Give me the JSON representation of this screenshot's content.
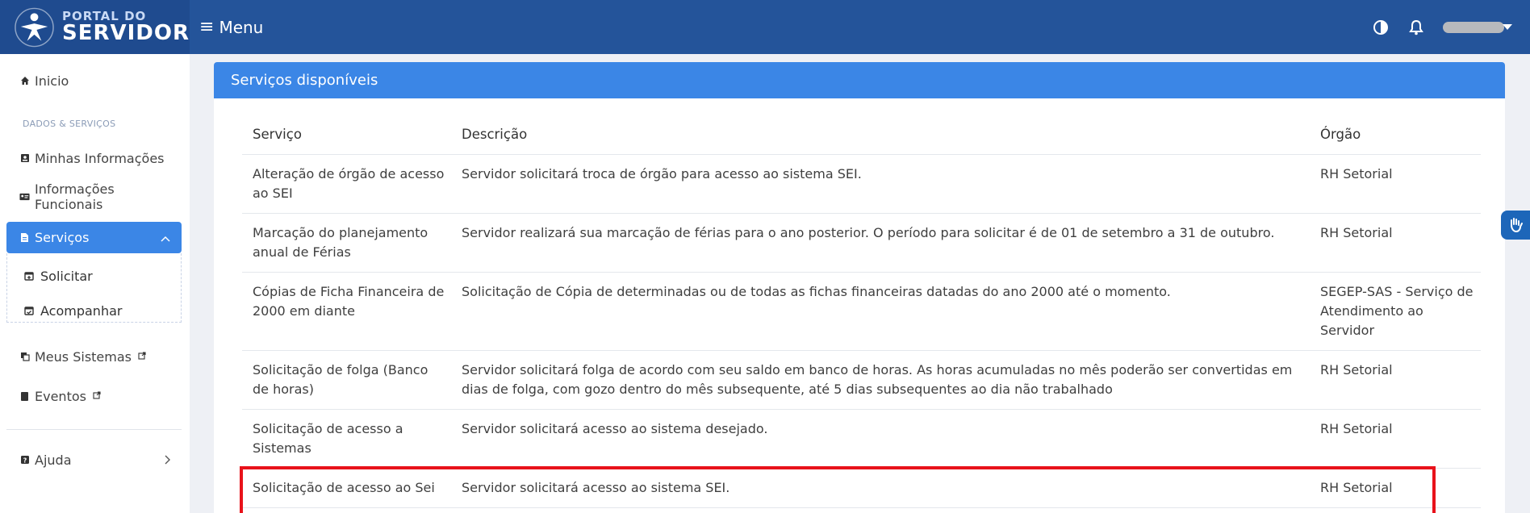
{
  "header": {
    "logo_line1": "PORTAL DO",
    "logo_line2": "SERVIDOR",
    "menu_label": "Menu",
    "icons": [
      "contrast-icon",
      "bell-icon",
      "user-menu-caret-icon"
    ],
    "colors": {
      "header_bg": "#24549a",
      "accent": "#3b86e6",
      "highlight": "#e8121b"
    }
  },
  "sidebar": {
    "inicio": "Inicio",
    "section": "DADOS & SERVIÇOS",
    "minhas": "Minhas Informações",
    "funcionais": "Informações Funcionais",
    "servicos": "Serviços",
    "solicitar": "Solicitar",
    "acompanhar": "Acompanhar",
    "sistemas": "Meus Sistemas",
    "eventos": "Eventos",
    "ajuda": "Ajuda"
  },
  "panel": {
    "title": "Serviços disponíveis",
    "columns": [
      "Serviço",
      "Descrição",
      "Órgão"
    ],
    "rows": [
      {
        "servico": "Alteração de órgão de acesso ao SEI",
        "descricao": "Servidor solicitará troca de órgão para acesso ao sistema SEI.",
        "orgao": "RH Setorial"
      },
      {
        "servico": "Marcação do planejamento anual de Férias",
        "descricao": "Servidor realizará sua marcação de férias para o ano posterior. O período para solicitar é de 01 de setembro a 31 de outubro.",
        "orgao": "RH Setorial"
      },
      {
        "servico": "Cópias de Ficha Financeira de 2000 em diante",
        "descricao": "Solicitação de Cópia de determinadas ou de todas as fichas financeiras datadas do ano 2000 até o momento.",
        "orgao": "SEGEP-SAS - Serviço de Atendimento ao Servidor"
      },
      {
        "servico": "Solicitação de folga (Banco de horas)",
        "descricao": "Servidor solicitará folga de acordo com seu saldo em banco de horas. As horas acumuladas no mês poderão ser convertidas em dias de folga, com gozo dentro do mês subsequente, até 5 dias subsequentes ao dia não trabalhado",
        "orgao": "RH Setorial"
      },
      {
        "servico": "Solicitação de acesso a Sistemas",
        "descricao": "Servidor solicitará acesso ao sistema desejado.",
        "orgao": "RH Setorial"
      },
      {
        "servico": "Solicitação de acesso ao Sei",
        "descricao": "Servidor solicitará acesso ao sistema SEI.",
        "orgao": "RH Setorial"
      }
    ]
  }
}
